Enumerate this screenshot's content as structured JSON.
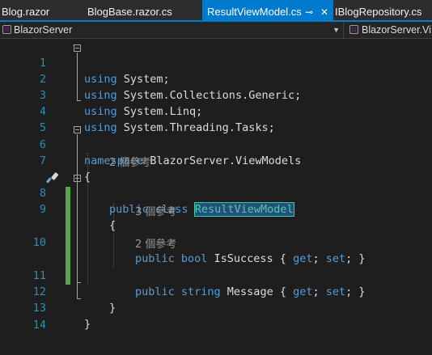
{
  "tabs": [
    {
      "label": "Blog.razor"
    },
    {
      "label": "BlogBase.razor.cs"
    },
    {
      "label": "ResultViewModel.cs",
      "active": true,
      "pin": "⊸",
      "close": "✕"
    },
    {
      "label": "IBlogRepository.cs"
    }
  ],
  "nav": {
    "project": "BlazorServer",
    "member": "BlazorServer.Vi"
  },
  "editor": {
    "line_numbers": [
      "1",
      "2",
      "3",
      "4",
      "5",
      "6",
      "7",
      "8",
      "9",
      "10",
      "11",
      "12",
      "13",
      "14"
    ],
    "lines": {
      "l1": {
        "kw": "using",
        "rest": " System;"
      },
      "l2": {
        "kw": "using",
        "rest": " System.Collections.Generic;"
      },
      "l3": {
        "kw": "using",
        "rest": " System.Linq;"
      },
      "l4": {
        "kw": "using",
        "rest": " System.Threading.Tasks;"
      },
      "l6": {
        "kw": "namespace",
        "rest": " BlazorServer.ViewModels"
      },
      "l7": {
        "text": "{"
      },
      "lens_class": "2 個參考",
      "l8": {
        "kw": "public class",
        "type": "ResultViewModel"
      },
      "l9": {
        "text": "{"
      },
      "lens_success": "3 個參考",
      "l10": {
        "kw1": "public bool",
        "name": " IsSuccess { ",
        "get": "get",
        "sep1": "; ",
        "set": "set",
        "end": "; }"
      },
      "lens_message": "2 個參考",
      "l11": {
        "kw1": "public string",
        "name": " Message { ",
        "get": "get",
        "sep1": "; ",
        "set": "set",
        "end": "; }"
      },
      "l12": {
        "text": "}"
      },
      "l13": {
        "text": "}"
      }
    }
  },
  "colors": {
    "background": "#1e1e1e",
    "accent": "#007acc",
    "keyword": "#569cd6",
    "type": "#4ec9b0",
    "line_number": "#2b91af",
    "change_bar": "#57a64a"
  }
}
